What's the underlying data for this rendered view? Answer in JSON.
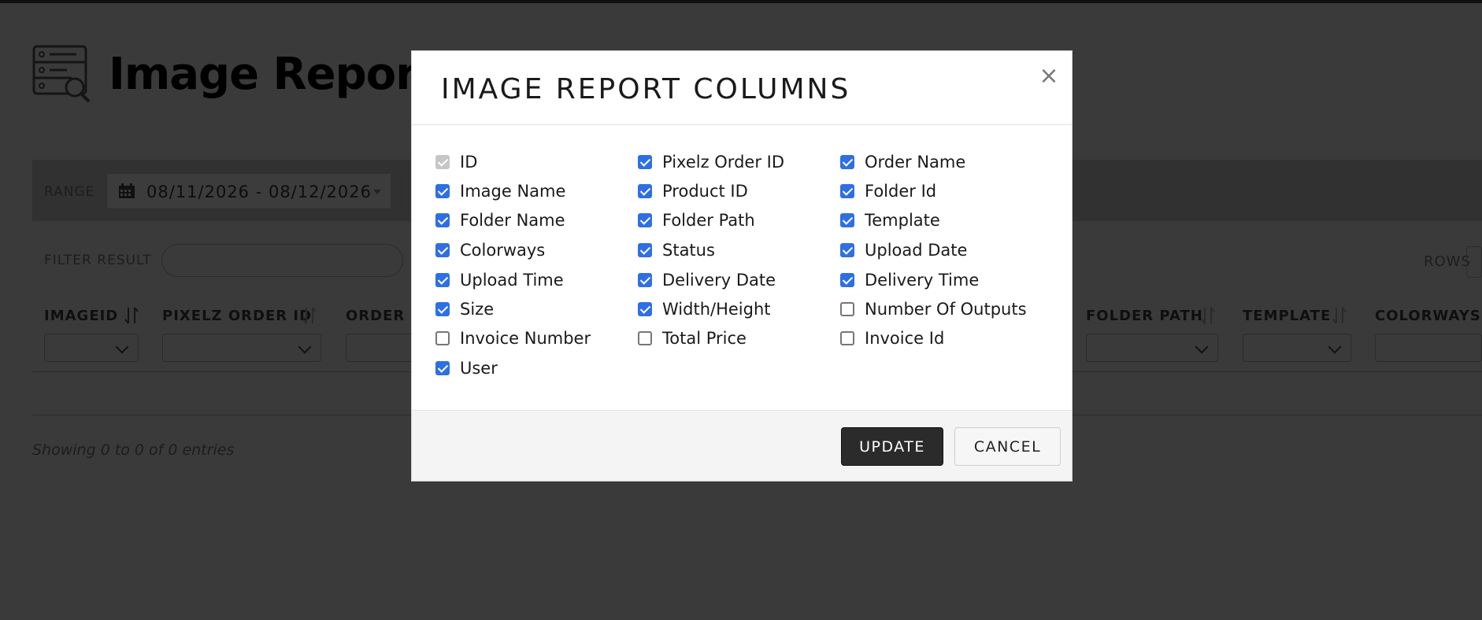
{
  "page": {
    "title": "Image Report",
    "range_label": "RANGE",
    "date_range": "08/11/2026 - 08/12/2026",
    "filter_label": "FILTER RESULT",
    "rows_label": "ROWS",
    "showing_text": "Showing 0 to 0 of 0 entries",
    "columns": [
      "IMAGEID",
      "PIXELZ ORDER ID",
      "ORDER N",
      "FOLDER PATH",
      "TEMPLATE",
      "COLORWAYS"
    ]
  },
  "modal": {
    "title": "IMAGE REPORT COLUMNS",
    "close_label": "×",
    "checkboxes": [
      {
        "label": "ID",
        "state": "disabled-checked"
      },
      {
        "label": "Pixelz Order ID",
        "state": "checked"
      },
      {
        "label": "Order Name",
        "state": "checked"
      },
      {
        "label": "Image Name",
        "state": "checked"
      },
      {
        "label": "Product ID",
        "state": "checked"
      },
      {
        "label": "Folder Id",
        "state": "checked"
      },
      {
        "label": "Folder Name",
        "state": "checked"
      },
      {
        "label": "Folder Path",
        "state": "checked"
      },
      {
        "label": "Template",
        "state": "checked"
      },
      {
        "label": "Colorways",
        "state": "checked"
      },
      {
        "label": "Status",
        "state": "checked"
      },
      {
        "label": "Upload Date",
        "state": "checked"
      },
      {
        "label": "Upload Time",
        "state": "checked"
      },
      {
        "label": "Delivery Date",
        "state": "checked"
      },
      {
        "label": "Delivery Time",
        "state": "checked"
      },
      {
        "label": "Size",
        "state": "checked"
      },
      {
        "label": "Width/Height",
        "state": "checked"
      },
      {
        "label": "Number Of Outputs",
        "state": "unchecked"
      },
      {
        "label": "Invoice Number",
        "state": "unchecked"
      },
      {
        "label": "Total Price",
        "state": "unchecked"
      },
      {
        "label": "Invoice Id",
        "state": "unchecked"
      },
      {
        "label": "User",
        "state": "checked"
      }
    ],
    "update_label": "UPDATE",
    "cancel_label": "CANCEL"
  },
  "colors": {
    "overlay": "#3a3a3a",
    "checkbox_accent": "#2f6fe4",
    "update_button": "#2b2b2b"
  }
}
